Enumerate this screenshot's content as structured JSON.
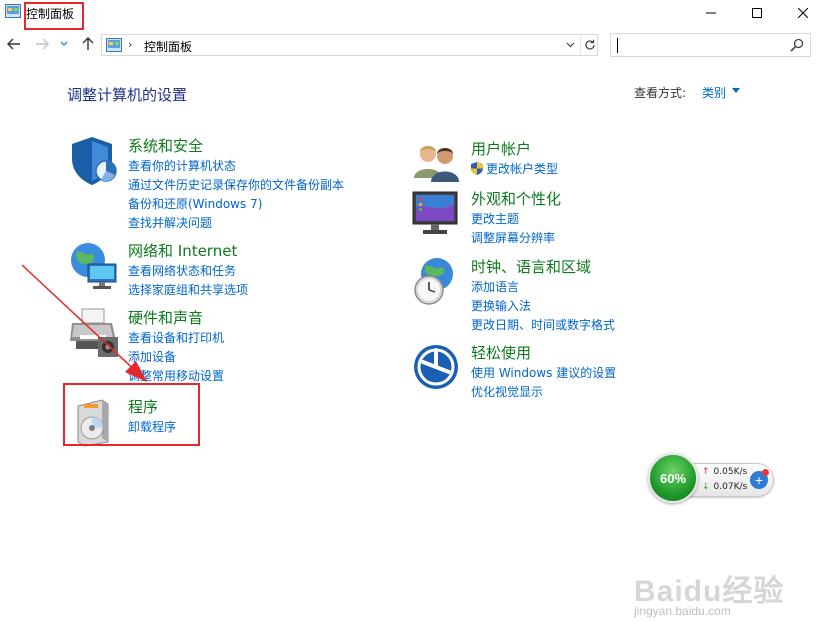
{
  "window": {
    "title": "控制面板",
    "controls": [
      "minimize",
      "maximize",
      "close"
    ]
  },
  "nav": {
    "breadcrumb": "控制面板",
    "breadcrumb_separator": "›",
    "search_placeholder": ""
  },
  "main": {
    "title": "调整计算机的设置",
    "view_by_label": "查看方式:",
    "view_by_value": "类别"
  },
  "categories": {
    "system_security": {
      "title": "系统和安全",
      "links": [
        "查看你的计算机状态",
        "通过文件历史记录保存你的文件备份副本",
        "备份和还原(Windows 7)",
        "查找并解决问题"
      ]
    },
    "network": {
      "title": "网络和 Internet",
      "links": [
        "查看网络状态和任务",
        "选择家庭组和共享选项"
      ]
    },
    "hardware": {
      "title": "硬件和声音",
      "links": [
        "查看设备和打印机",
        "添加设备",
        "调整常用移动设置"
      ]
    },
    "programs": {
      "title": "程序",
      "links": [
        "卸载程序"
      ]
    },
    "user_accounts": {
      "title": "用户帐户",
      "links": [
        "更改帐户类型"
      ]
    },
    "appearance": {
      "title": "外观和个性化",
      "links": [
        "更改主题",
        "调整屏幕分辨率"
      ]
    },
    "clock_region": {
      "title": "时钟、语言和区域",
      "links": [
        "添加语言",
        "更换输入法",
        "更改日期、时间或数字格式"
      ]
    },
    "ease_of_access": {
      "title": "轻松使用",
      "links": [
        "使用 Windows 建议的设置",
        "优化视觉显示"
      ]
    }
  },
  "net_widget": {
    "percent": "60%",
    "up_speed": "0.05K/s",
    "down_speed": "0.07K/s",
    "up_arrow": "↑",
    "down_arrow": "↓",
    "plus": "+"
  },
  "watermark": {
    "text": "Baidu经验",
    "url": "jingyan.baidu.com"
  },
  "colors": {
    "category_title": "#0d7a1d",
    "link": "#0066cc",
    "page_title": "#1e3287",
    "highlight": "#e8262c"
  },
  "icons": {
    "title": "control-panel-icon",
    "back": "arrow-left-icon",
    "forward": "arrow-right-icon",
    "recent": "chevron-down-icon",
    "up": "arrow-up-icon",
    "refresh": "refresh-icon",
    "search": "search-icon",
    "system_security": "shield-icon",
    "network": "network-globe-icon",
    "hardware": "printer-icon",
    "programs": "program-disc-icon",
    "user_accounts": "users-icon",
    "appearance": "monitor-icon",
    "clock_region": "clock-globe-icon",
    "ease_of_access": "accessibility-icon"
  }
}
